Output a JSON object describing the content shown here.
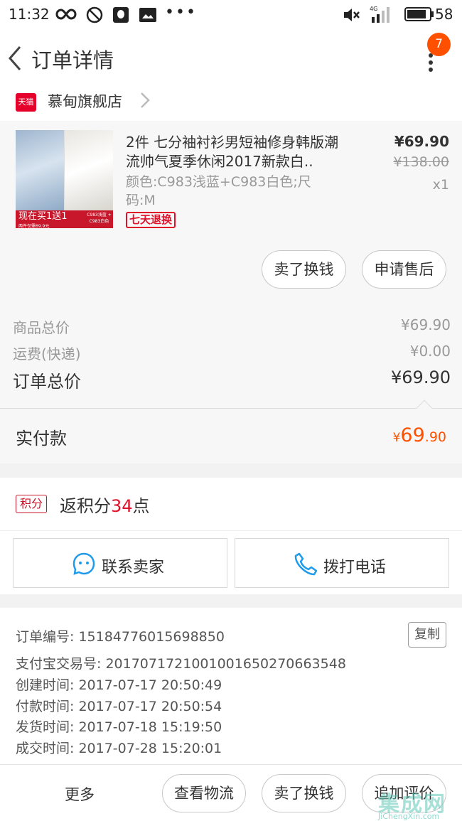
{
  "status_bar": {
    "time": "11:32",
    "battery": "58",
    "network": "4G"
  },
  "header": {
    "title": "订单详情",
    "badge_count": "7"
  },
  "shop": {
    "tag": "天猫",
    "name": "慕甸旗舰店"
  },
  "item": {
    "title": "2件 七分袖衬衫男短袖修身韩版潮流帅气夏季休闲2017新款白..",
    "spec": "颜色:C983浅蓝+C983白色;尺码:M",
    "price": "¥69.90",
    "original_price": "¥138.00",
    "quantity": "x1",
    "tag": "七天退换",
    "thumb_promo": "现在买1送1",
    "thumb_promo_sub": "两件仅需69.9元",
    "thumb_promo_right": "C983浅蓝 + C983白色",
    "actions": [
      "卖了换钱",
      "申请售后"
    ]
  },
  "summary": {
    "goods_total_label": "商品总价",
    "goods_total": "¥69.90",
    "shipping_label": "运费(快递)",
    "shipping": "¥0.00",
    "order_total_label": "订单总价",
    "order_total": "¥69.90"
  },
  "payment": {
    "label": "实付款",
    "currency": "¥",
    "integer": "69",
    "decimal": ".90"
  },
  "points": {
    "tag": "积分",
    "prefix": "返积分",
    "value": "34",
    "suffix": "点"
  },
  "contact": {
    "seller": "联系卖家",
    "phone": "拨打电话"
  },
  "order_info": {
    "copy": "复制",
    "rows": [
      "订单编号: 15184776015698850",
      "支付宝交易号: 2017071721001001650270663548",
      "创建时间: 2017-07-17 20:50:49",
      "付款时间: 2017-07-17 20:50:54",
      "发货时间: 2017-07-18 15:19:50",
      "成交时间: 2017-07-28 15:20:01"
    ]
  },
  "bottom_bar": {
    "more": "更多",
    "buttons": [
      "查看物流",
      "卖了换钱",
      "追加评价"
    ]
  },
  "watermark": {
    "text": "集成网",
    "url": "JiChengXin.com"
  },
  "colors": {
    "accent": "#ff5000",
    "tmall_red": "#e4002b",
    "contact_blue": "#1f9bea"
  }
}
